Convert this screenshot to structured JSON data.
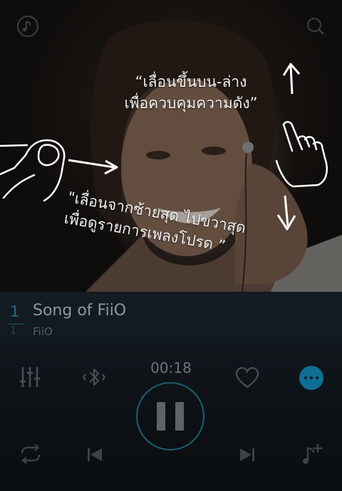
{
  "top_bar": {
    "music_icon": "music-note-icon",
    "search_icon": "search-icon"
  },
  "guide": {
    "volume_line1": "“เลื่อนขึ้นบน-ล่าง",
    "volume_line2": "เพื่อควบคุมความดัง”",
    "playlist_line1": "\"เลื่อนจากซ้ายสุด ไปขวาสุด",
    "playlist_line2": "เพื่อดูรายการเพลงโปรด ”"
  },
  "now_playing": {
    "track_number": "1",
    "track_number_small": "1",
    "title": "Song of FiiO",
    "artist": "FiiO",
    "time": "00:18"
  },
  "controls": {
    "equalizer_icon": "equalizer-icon",
    "bluetooth_icon": "bluetooth-icon",
    "heart_icon": "heart-icon",
    "more_icon": "more-icon",
    "pause_icon": "pause-icon",
    "repeat_icon": "repeat-icon",
    "previous_icon": "previous-icon",
    "next_icon": "next-icon",
    "add_playlist_icon": "add-to-playlist-icon"
  },
  "colors": {
    "accent": "#1e7fa6",
    "more_button": "#0f6e93"
  }
}
